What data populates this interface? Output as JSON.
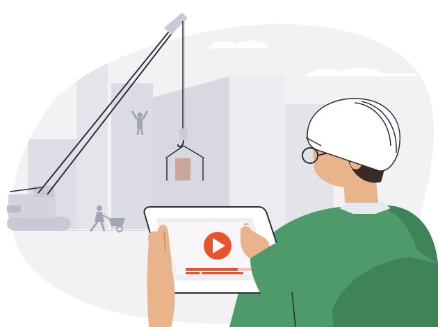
{
  "scene": {
    "subject": "construction-worker-with-tablet",
    "icons": [
      "play-icon",
      "crane-icon",
      "hard-hat-icon",
      "wheelbarrow-icon"
    ],
    "colors": {
      "backdrop": "#f2f1f3",
      "buildings": "#dcdce4",
      "buildings_light": "#e8e8ee",
      "crane": "#c9cad6",
      "crane_line": "#2b2b3a",
      "shirt": "#4f9a6b",
      "shirt_dark": "#3f8458",
      "skin": "#e9b48c",
      "hair": "#3a2a25",
      "helmet": "#ffffff",
      "tablet": "#ffffff",
      "tablet_screen": "#eeeef3",
      "play_button": "#e8532e",
      "progress_bar": "#e8532e",
      "cargo": "#c9a89a"
    }
  }
}
